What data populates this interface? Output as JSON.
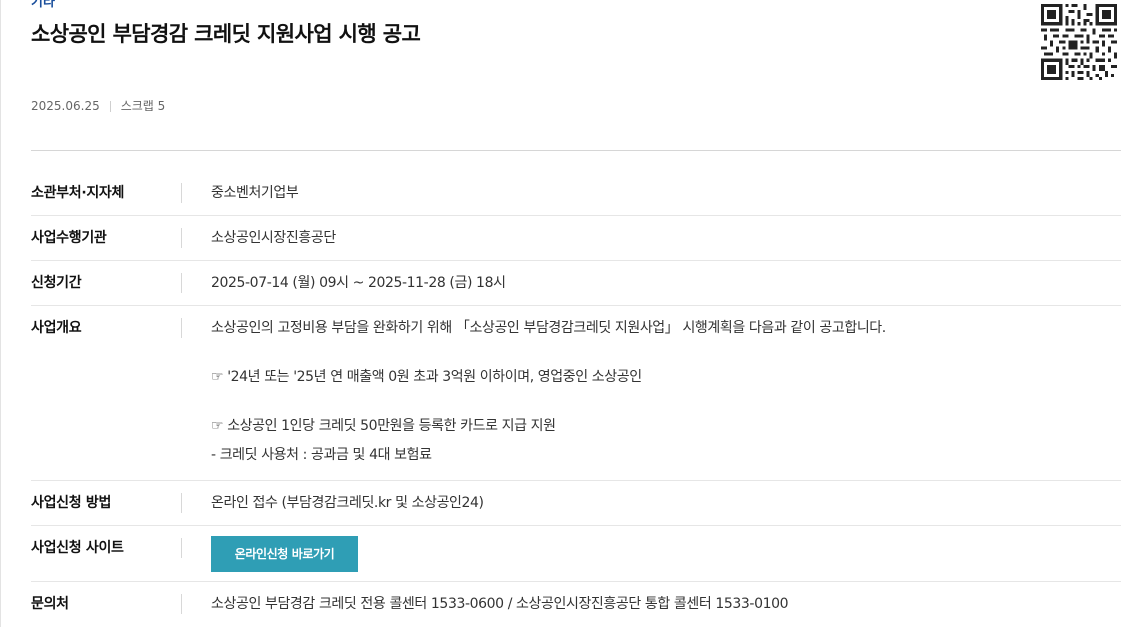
{
  "header": {
    "category": "기타",
    "title": "소상공인 부담경감 크레딧 지원사업 시행 공고"
  },
  "meta": {
    "date": "2025.06.25",
    "scrap_label": "스크랩 5"
  },
  "rows": [
    {
      "label": "소관부처·지자체",
      "value": "중소벤처기업부"
    },
    {
      "label": "사업수행기관",
      "value": "소상공인시장진흥공단"
    },
    {
      "label": "신청기간",
      "value": "2025-07-14 (월) 09시 ~ 2025-11-28 (금) 18시"
    },
    {
      "label": "사업개요",
      "lines": [
        "소상공인의 고정비용 부담을 완화하기 위해 「소상공인 부담경감크레딧 지원사업」 시행계획을 다음과 같이 공고합니다.",
        "☞ '24년 또는 '25년 연 매출액 0원 초과 3억원 이하이며, 영업중인 소상공인",
        "☞ 소상공인 1인당 크레딧 50만원을 등록한 카드로 지급 지원",
        "- 크레딧 사용처 : 공과금 및 4대 보험료"
      ]
    },
    {
      "label": "사업신청 방법",
      "value": "온라인 접수 (부담경감크레딧.kr 및 소상공인24)"
    },
    {
      "label": "사업신청 사이트",
      "button": "온라인신청 바로가기"
    },
    {
      "label": "문의처",
      "value": "소상공인 부담경감 크레딧 전용 콜센터 1533-0600 / 소상공인시장진흥공단 통합 콜센터 1533-0100"
    }
  ],
  "icons": {
    "qr": "qr-code-icon"
  },
  "colors": {
    "category": "#1a4f9c",
    "button_bg": "#2f9eb5"
  }
}
